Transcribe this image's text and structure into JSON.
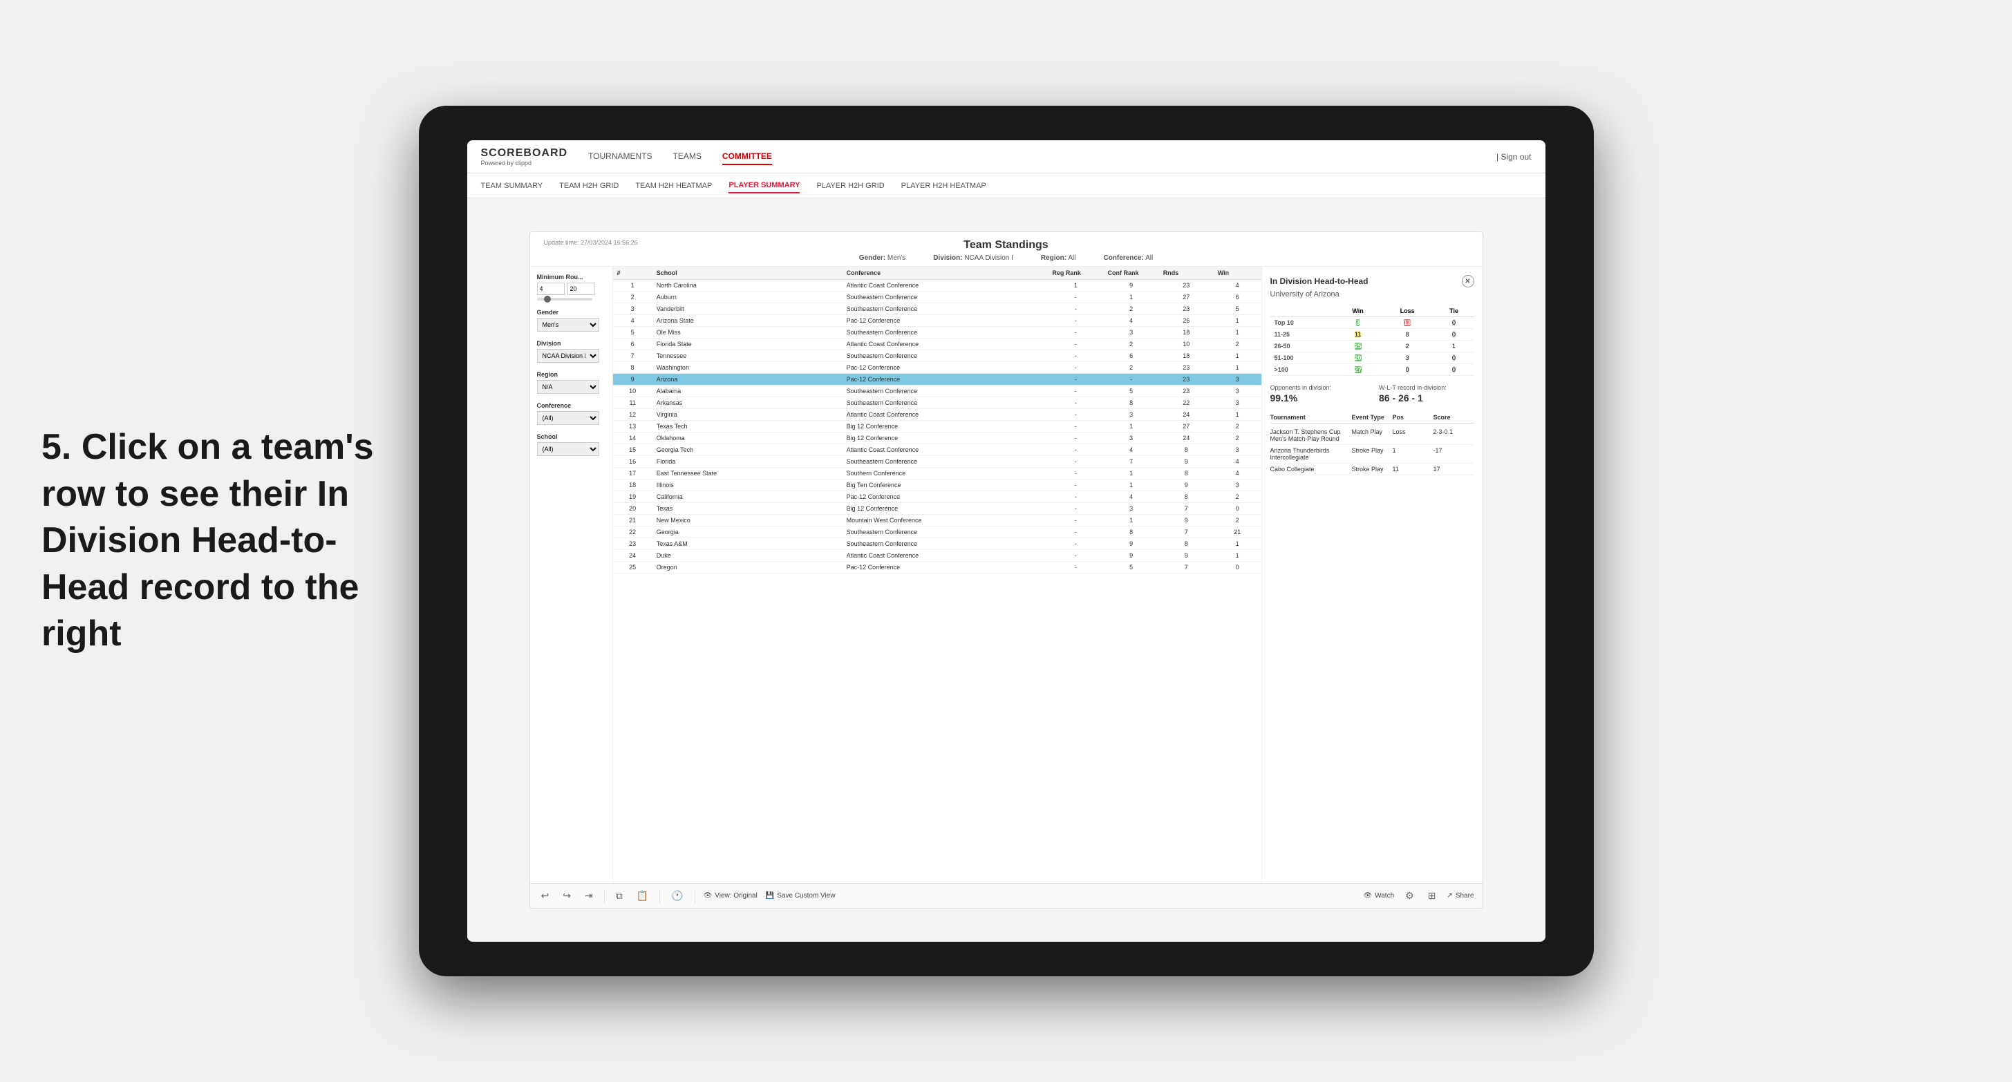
{
  "annotation": {
    "text": "5. Click on a team's row to see their In Division Head-to-Head record to the right"
  },
  "nav": {
    "logo": "SCOREBOARD",
    "logo_sub": "Powered by clippd",
    "links": [
      "TOURNAMENTS",
      "TEAMS",
      "COMMITTEE"
    ],
    "active_link": "COMMITTEE",
    "sign_out": "Sign out"
  },
  "sub_nav": {
    "links": [
      "TEAM SUMMARY",
      "TEAM H2H GRID",
      "TEAM H2H HEATMAP",
      "PLAYER SUMMARY",
      "PLAYER H2H GRID",
      "PLAYER H2H HEATMAP"
    ],
    "active_link": "PLAYER SUMMARY"
  },
  "panel": {
    "update_time": "Update time: 27/03/2024 16:56:26",
    "title": "Team Standings",
    "gender_label": "Gender:",
    "gender_value": "Men's",
    "division_label": "Division:",
    "division_value": "NCAA Division I",
    "region_label": "Region:",
    "region_value": "All",
    "conference_label": "Conference:",
    "conference_value": "All"
  },
  "filters": {
    "min_rounds_label": "Minimum Rou...",
    "min_rounds_val1": "4",
    "min_rounds_val2": "20",
    "gender_label": "Gender",
    "gender_value": "Men's",
    "division_label": "Division",
    "division_value": "NCAA Division I",
    "region_label": "Region",
    "region_value": "N/A",
    "conference_label": "Conference",
    "conference_value": "(All)",
    "school_label": "School",
    "school_value": "(All)"
  },
  "table": {
    "headers": [
      "#",
      "School",
      "Conference",
      "Reg Rank",
      "Conf Rank",
      "Rnds",
      "Win"
    ],
    "rows": [
      {
        "num": "1",
        "school": "North Carolina",
        "conf": "Atlantic Coast Conference",
        "reg_rank": "1",
        "conf_rank": "9",
        "rnds": "23",
        "win": "4"
      },
      {
        "num": "2",
        "school": "Auburn",
        "conf": "Southeastern Conference",
        "reg_rank": "-",
        "conf_rank": "1",
        "rnds": "27",
        "win": "6"
      },
      {
        "num": "3",
        "school": "Vanderbilt",
        "conf": "Southeastern Conference",
        "reg_rank": "-",
        "conf_rank": "2",
        "rnds": "23",
        "win": "5"
      },
      {
        "num": "4",
        "school": "Arizona State",
        "conf": "Pac-12 Conference",
        "reg_rank": "-",
        "conf_rank": "4",
        "rnds": "26",
        "win": "1"
      },
      {
        "num": "5",
        "school": "Ole Miss",
        "conf": "Southeastern Conference",
        "reg_rank": "-",
        "conf_rank": "3",
        "rnds": "18",
        "win": "1"
      },
      {
        "num": "6",
        "school": "Florida State",
        "conf": "Atlantic Coast Conference",
        "reg_rank": "-",
        "conf_rank": "2",
        "rnds": "10",
        "win": "2"
      },
      {
        "num": "7",
        "school": "Tennessee",
        "conf": "Southeastern Conference",
        "reg_rank": "-",
        "conf_rank": "6",
        "rnds": "18",
        "win": "1"
      },
      {
        "num": "8",
        "school": "Washington",
        "conf": "Pac-12 Conference",
        "reg_rank": "-",
        "conf_rank": "2",
        "rnds": "23",
        "win": "1"
      },
      {
        "num": "9",
        "school": "Arizona",
        "conf": "Pac-12 Conference",
        "reg_rank": "-",
        "conf_rank": "-",
        "rnds": "23",
        "win": "3",
        "highlighted": true
      },
      {
        "num": "10",
        "school": "Alabama",
        "conf": "Southeastern Conference",
        "reg_rank": "-",
        "conf_rank": "5",
        "rnds": "23",
        "win": "3"
      },
      {
        "num": "11",
        "school": "Arkansas",
        "conf": "Southeastern Conference",
        "reg_rank": "-",
        "conf_rank": "8",
        "rnds": "22",
        "win": "3"
      },
      {
        "num": "12",
        "school": "Virginia",
        "conf": "Atlantic Coast Conference",
        "reg_rank": "-",
        "conf_rank": "3",
        "rnds": "24",
        "win": "1"
      },
      {
        "num": "13",
        "school": "Texas Tech",
        "conf": "Big 12 Conference",
        "reg_rank": "-",
        "conf_rank": "1",
        "rnds": "27",
        "win": "2"
      },
      {
        "num": "14",
        "school": "Oklahoma",
        "conf": "Big 12 Conference",
        "reg_rank": "-",
        "conf_rank": "3",
        "rnds": "24",
        "win": "2"
      },
      {
        "num": "15",
        "school": "Georgia Tech",
        "conf": "Atlantic Coast Conference",
        "reg_rank": "-",
        "conf_rank": "4",
        "rnds": "8",
        "win": "3"
      },
      {
        "num": "16",
        "school": "Florida",
        "conf": "Southeastern Conference",
        "reg_rank": "-",
        "conf_rank": "7",
        "rnds": "9",
        "win": "4"
      },
      {
        "num": "17",
        "school": "East Tennessee State",
        "conf": "Southern Conference",
        "reg_rank": "-",
        "conf_rank": "1",
        "rnds": "8",
        "win": "4"
      },
      {
        "num": "18",
        "school": "Illinois",
        "conf": "Big Ten Conference",
        "reg_rank": "-",
        "conf_rank": "1",
        "rnds": "9",
        "win": "3"
      },
      {
        "num": "19",
        "school": "California",
        "conf": "Pac-12 Conference",
        "reg_rank": "-",
        "conf_rank": "4",
        "rnds": "8",
        "win": "2"
      },
      {
        "num": "20",
        "school": "Texas",
        "conf": "Big 12 Conference",
        "reg_rank": "-",
        "conf_rank": "3",
        "rnds": "7",
        "win": "0"
      },
      {
        "num": "21",
        "school": "New Mexico",
        "conf": "Mountain West Conference",
        "reg_rank": "-",
        "conf_rank": "1",
        "rnds": "9",
        "win": "2"
      },
      {
        "num": "22",
        "school": "Georgia",
        "conf": "Southeastern Conference",
        "reg_rank": "-",
        "conf_rank": "8",
        "rnds": "7",
        "win": "21"
      },
      {
        "num": "23",
        "school": "Texas A&M",
        "conf": "Southeastern Conference",
        "reg_rank": "-",
        "conf_rank": "9",
        "rnds": "8",
        "win": "1"
      },
      {
        "num": "24",
        "school": "Duke",
        "conf": "Atlantic Coast Conference",
        "reg_rank": "-",
        "conf_rank": "9",
        "rnds": "9",
        "win": "1"
      },
      {
        "num": "25",
        "school": "Oregon",
        "conf": "Pac-12 Conference",
        "reg_rank": "-",
        "conf_rank": "5",
        "rnds": "7",
        "win": "0"
      }
    ]
  },
  "h2h": {
    "title": "In Division Head-to-Head",
    "team": "University of Arizona",
    "grid": {
      "headers": [
        "",
        "Win",
        "Loss",
        "Tie"
      ],
      "rows": [
        {
          "label": "Top 10",
          "win": "3",
          "loss": "13",
          "tie": "0",
          "win_class": "cell-green",
          "loss_class": "cell-red",
          "tie_class": "cell-gray"
        },
        {
          "label": "11-25",
          "win": "11",
          "loss": "8",
          "tie": "0",
          "win_class": "cell-yellow",
          "loss_class": "",
          "tie_class": "cell-gray"
        },
        {
          "label": "26-50",
          "win": "25",
          "loss": "2",
          "tie": "1",
          "win_class": "cell-green",
          "loss_class": "",
          "tie_class": ""
        },
        {
          "label": "51-100",
          "win": "20",
          "loss": "3",
          "tie": "0",
          "win_class": "cell-green",
          "loss_class": "",
          "tie_class": "cell-gray"
        },
        {
          "label": ">100",
          "win": "27",
          "loss": "0",
          "tie": "0",
          "win_class": "cell-green",
          "loss_class": "cell-gray",
          "tie_class": "cell-gray"
        }
      ]
    },
    "opponents_label": "Opponents in division:",
    "opponents_value": "99.1%",
    "record_label": "W-L-T record in-division:",
    "record_value": "86 - 26 - 1",
    "tournaments_header": [
      "Tournament",
      "Event Type",
      "Pos",
      "Score"
    ],
    "tournaments": [
      {
        "name": "Jackson T. Stephens Cup Men's Match-Play Round",
        "type": "Match Play",
        "pos": "Loss",
        "score": "2-3-0 1"
      },
      {
        "name": "Arizona Thunderbirds Intercollegiate",
        "type": "Stroke Play",
        "pos": "1",
        "score": "-17"
      },
      {
        "name": "Cabo Collegiate",
        "type": "Stroke Play",
        "pos": "11",
        "score": "17"
      }
    ]
  },
  "toolbar": {
    "view_original": "View: Original",
    "save_custom": "Save Custom View",
    "watch": "Watch",
    "share": "Share"
  }
}
